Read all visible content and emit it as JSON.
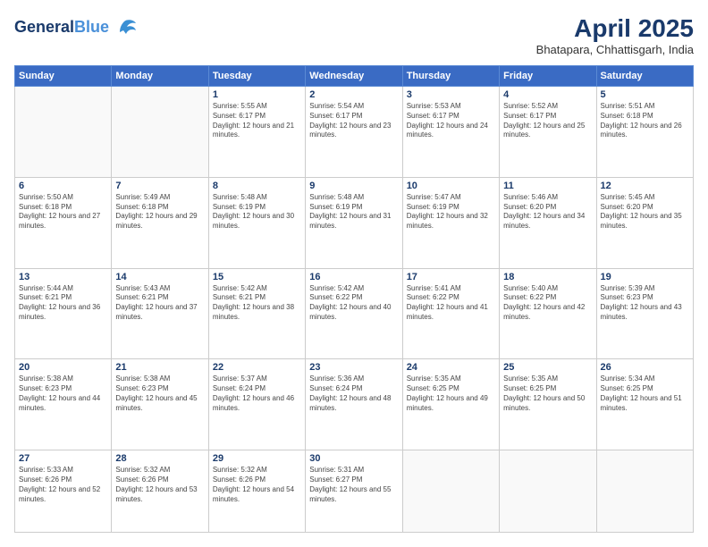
{
  "header": {
    "logo_line1": "General",
    "logo_line2": "Blue",
    "title": "April 2025",
    "subtitle": "Bhatapara, Chhattisgarh, India"
  },
  "weekdays": [
    "Sunday",
    "Monday",
    "Tuesday",
    "Wednesday",
    "Thursday",
    "Friday",
    "Saturday"
  ],
  "weeks": [
    [
      {
        "day": "",
        "info": ""
      },
      {
        "day": "",
        "info": ""
      },
      {
        "day": "1",
        "info": "Sunrise: 5:55 AM\nSunset: 6:17 PM\nDaylight: 12 hours and 21 minutes."
      },
      {
        "day": "2",
        "info": "Sunrise: 5:54 AM\nSunset: 6:17 PM\nDaylight: 12 hours and 23 minutes."
      },
      {
        "day": "3",
        "info": "Sunrise: 5:53 AM\nSunset: 6:17 PM\nDaylight: 12 hours and 24 minutes."
      },
      {
        "day": "4",
        "info": "Sunrise: 5:52 AM\nSunset: 6:17 PM\nDaylight: 12 hours and 25 minutes."
      },
      {
        "day": "5",
        "info": "Sunrise: 5:51 AM\nSunset: 6:18 PM\nDaylight: 12 hours and 26 minutes."
      }
    ],
    [
      {
        "day": "6",
        "info": "Sunrise: 5:50 AM\nSunset: 6:18 PM\nDaylight: 12 hours and 27 minutes."
      },
      {
        "day": "7",
        "info": "Sunrise: 5:49 AM\nSunset: 6:18 PM\nDaylight: 12 hours and 29 minutes."
      },
      {
        "day": "8",
        "info": "Sunrise: 5:48 AM\nSunset: 6:19 PM\nDaylight: 12 hours and 30 minutes."
      },
      {
        "day": "9",
        "info": "Sunrise: 5:48 AM\nSunset: 6:19 PM\nDaylight: 12 hours and 31 minutes."
      },
      {
        "day": "10",
        "info": "Sunrise: 5:47 AM\nSunset: 6:19 PM\nDaylight: 12 hours and 32 minutes."
      },
      {
        "day": "11",
        "info": "Sunrise: 5:46 AM\nSunset: 6:20 PM\nDaylight: 12 hours and 34 minutes."
      },
      {
        "day": "12",
        "info": "Sunrise: 5:45 AM\nSunset: 6:20 PM\nDaylight: 12 hours and 35 minutes."
      }
    ],
    [
      {
        "day": "13",
        "info": "Sunrise: 5:44 AM\nSunset: 6:21 PM\nDaylight: 12 hours and 36 minutes."
      },
      {
        "day": "14",
        "info": "Sunrise: 5:43 AM\nSunset: 6:21 PM\nDaylight: 12 hours and 37 minutes."
      },
      {
        "day": "15",
        "info": "Sunrise: 5:42 AM\nSunset: 6:21 PM\nDaylight: 12 hours and 38 minutes."
      },
      {
        "day": "16",
        "info": "Sunrise: 5:42 AM\nSunset: 6:22 PM\nDaylight: 12 hours and 40 minutes."
      },
      {
        "day": "17",
        "info": "Sunrise: 5:41 AM\nSunset: 6:22 PM\nDaylight: 12 hours and 41 minutes."
      },
      {
        "day": "18",
        "info": "Sunrise: 5:40 AM\nSunset: 6:22 PM\nDaylight: 12 hours and 42 minutes."
      },
      {
        "day": "19",
        "info": "Sunrise: 5:39 AM\nSunset: 6:23 PM\nDaylight: 12 hours and 43 minutes."
      }
    ],
    [
      {
        "day": "20",
        "info": "Sunrise: 5:38 AM\nSunset: 6:23 PM\nDaylight: 12 hours and 44 minutes."
      },
      {
        "day": "21",
        "info": "Sunrise: 5:38 AM\nSunset: 6:23 PM\nDaylight: 12 hours and 45 minutes."
      },
      {
        "day": "22",
        "info": "Sunrise: 5:37 AM\nSunset: 6:24 PM\nDaylight: 12 hours and 46 minutes."
      },
      {
        "day": "23",
        "info": "Sunrise: 5:36 AM\nSunset: 6:24 PM\nDaylight: 12 hours and 48 minutes."
      },
      {
        "day": "24",
        "info": "Sunrise: 5:35 AM\nSunset: 6:25 PM\nDaylight: 12 hours and 49 minutes."
      },
      {
        "day": "25",
        "info": "Sunrise: 5:35 AM\nSunset: 6:25 PM\nDaylight: 12 hours and 50 minutes."
      },
      {
        "day": "26",
        "info": "Sunrise: 5:34 AM\nSunset: 6:25 PM\nDaylight: 12 hours and 51 minutes."
      }
    ],
    [
      {
        "day": "27",
        "info": "Sunrise: 5:33 AM\nSunset: 6:26 PM\nDaylight: 12 hours and 52 minutes."
      },
      {
        "day": "28",
        "info": "Sunrise: 5:32 AM\nSunset: 6:26 PM\nDaylight: 12 hours and 53 minutes."
      },
      {
        "day": "29",
        "info": "Sunrise: 5:32 AM\nSunset: 6:26 PM\nDaylight: 12 hours and 54 minutes."
      },
      {
        "day": "30",
        "info": "Sunrise: 5:31 AM\nSunset: 6:27 PM\nDaylight: 12 hours and 55 minutes."
      },
      {
        "day": "",
        "info": ""
      },
      {
        "day": "",
        "info": ""
      },
      {
        "day": "",
        "info": ""
      }
    ]
  ]
}
